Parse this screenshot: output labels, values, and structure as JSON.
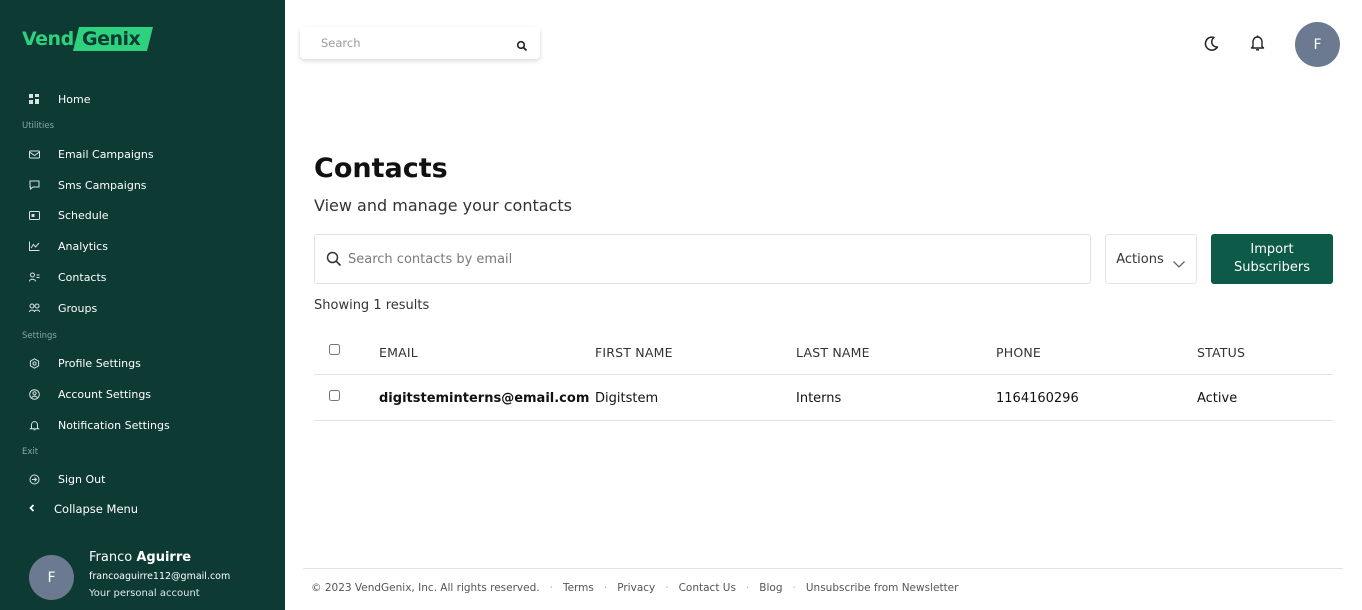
{
  "brand": {
    "part1": "Vend",
    "part2": "Genix",
    "colors": {
      "sidebar": "#0d3a33",
      "accent": "#2ed17e",
      "button": "#0c5a47"
    }
  },
  "sidebar": {
    "home": {
      "label": "Home",
      "icon": "dashboard-icon"
    },
    "utilities_label": "Utilities",
    "utilities": [
      {
        "label": "Email Campaigns",
        "icon": "mail-icon"
      },
      {
        "label": "Sms Campaigns",
        "icon": "chat-icon"
      },
      {
        "label": "Schedule",
        "icon": "calendar-icon"
      },
      {
        "label": "Analytics",
        "icon": "chart-icon"
      },
      {
        "label": "Contacts",
        "icon": "contacts-icon"
      },
      {
        "label": "Groups",
        "icon": "groups-icon"
      }
    ],
    "settings_label": "Settings",
    "settings": [
      {
        "label": "Profile Settings",
        "icon": "gear-icon"
      },
      {
        "label": "Account Settings",
        "icon": "user-circle-icon"
      },
      {
        "label": "Notification Settings",
        "icon": "bell-icon"
      }
    ],
    "exit_label": "Exit",
    "sign_out": {
      "label": "Sign Out",
      "icon": "logout-icon"
    },
    "collapse": {
      "label": "Collapse Menu",
      "icon": "chevron-left-icon"
    },
    "user": {
      "initial": "F",
      "first_name": "Franco",
      "last_name": "Aguirre",
      "email": "francoaguirre112@gmail.com",
      "subtitle": "Your personal account"
    }
  },
  "topbar": {
    "search_placeholder": "Search",
    "avatar_initial": "F"
  },
  "main": {
    "title": "Contacts",
    "subtitle": "View and manage your contacts",
    "search_placeholder": "Search contacts by email",
    "actions_label": "Actions",
    "import_label": "Import Subscribers",
    "results_text": "Showing 1 results",
    "table": {
      "headers": {
        "email": "EMAIL",
        "first_name": "FIRST NAME",
        "last_name": "LAST NAME",
        "phone": "PHONE",
        "status": "STATUS"
      },
      "rows": [
        {
          "email": "digitsteminterns@email.com",
          "first_name": "Digitstem",
          "last_name": "Interns",
          "phone": "1164160296",
          "status": "Active"
        }
      ]
    }
  },
  "footer": {
    "copyright": "© 2023 VendGenix, Inc. All rights reserved.",
    "links": [
      "Terms",
      "Privacy",
      "Contact Us",
      "Blog",
      "Unsubscribe from Newsletter"
    ]
  }
}
